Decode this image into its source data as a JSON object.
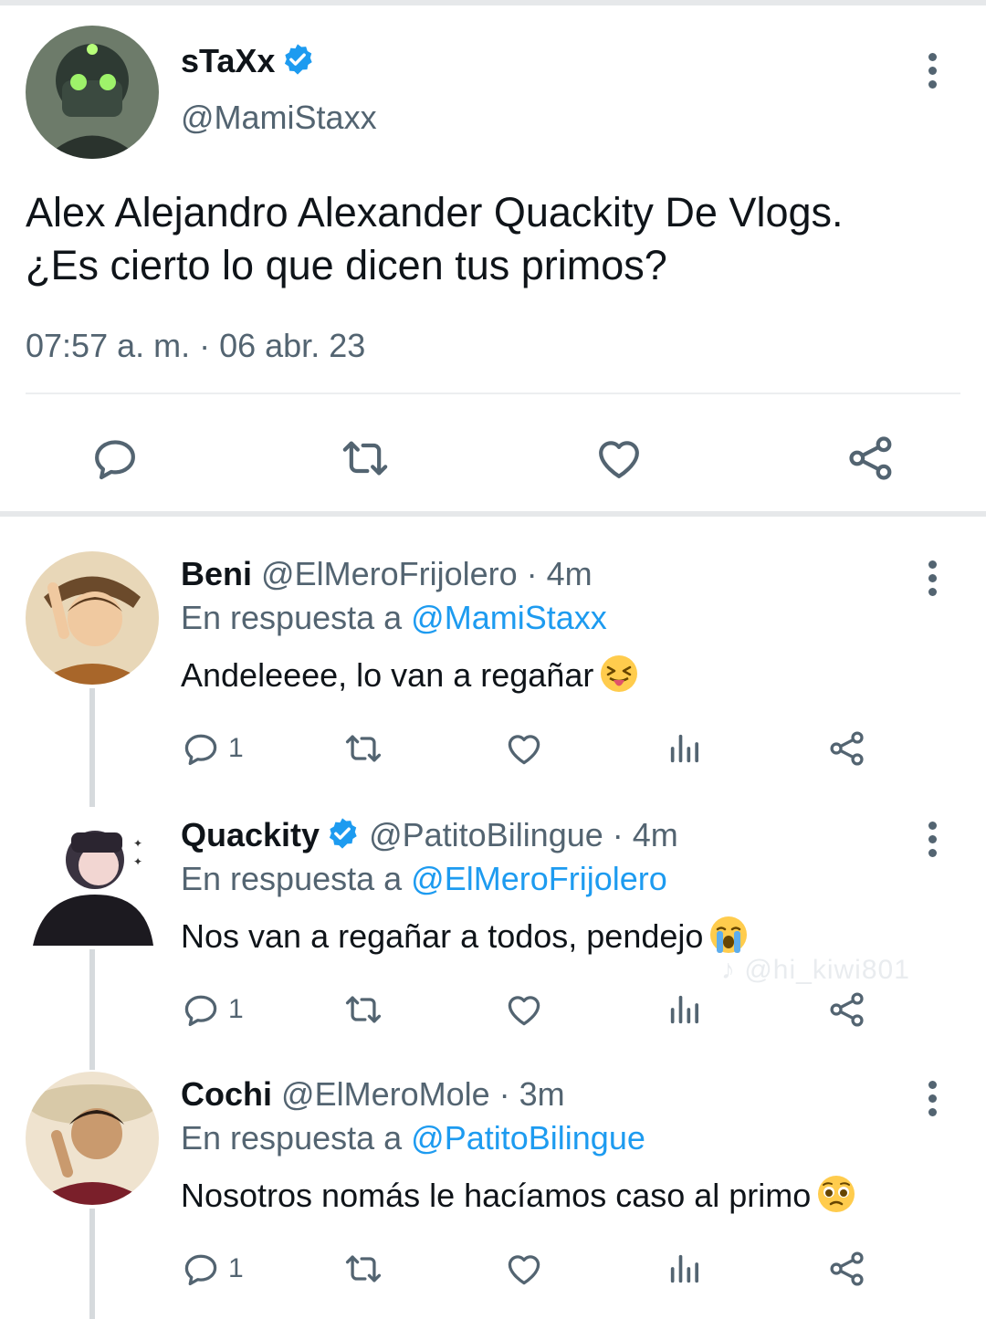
{
  "tweet": {
    "author_name": "sTaXx",
    "author_handle": "@MamiStaxx",
    "text_line1": "Alex Alejandro Alexander Quackity De Vlogs.",
    "text_line2": "¿Es cierto lo que dicen tus primos?",
    "timestamp": "07:57 a. m. · 06 abr. 23",
    "verified": true
  },
  "replies": [
    {
      "name": "Beni",
      "handle": "@ElMeroFrijolero",
      "time": "· 4m",
      "reply_prefix": "En respuesta a",
      "reply_to": "@MamiStaxx",
      "text": "Andeleeee, lo van a regañar",
      "emoji": "squinting-face-with-tongue",
      "reply_count": "1",
      "verified": false
    },
    {
      "name": "Quackity",
      "handle": "@PatitoBilingue",
      "time": "· 4m",
      "reply_prefix": "En respuesta a",
      "reply_to": "@ElMeroFrijolero",
      "text": "Nos van a regañar a todos, pendejo",
      "emoji": "loudly-crying-face",
      "reply_count": "1",
      "verified": true
    },
    {
      "name": "Cochi",
      "handle": "@ElMeroMole",
      "time": "· 3m",
      "reply_prefix": "En respuesta a",
      "reply_to": "@PatitoBilingue",
      "text": "Nosotros nomás le hacíamos caso al primo",
      "emoji": "pleading-face",
      "reply_count": "1",
      "verified": false
    }
  ],
  "watermark": "@hi_kiwi801",
  "colors": {
    "accent": "#1d9bf0",
    "muted": "#536471",
    "text": "#0f1419"
  }
}
